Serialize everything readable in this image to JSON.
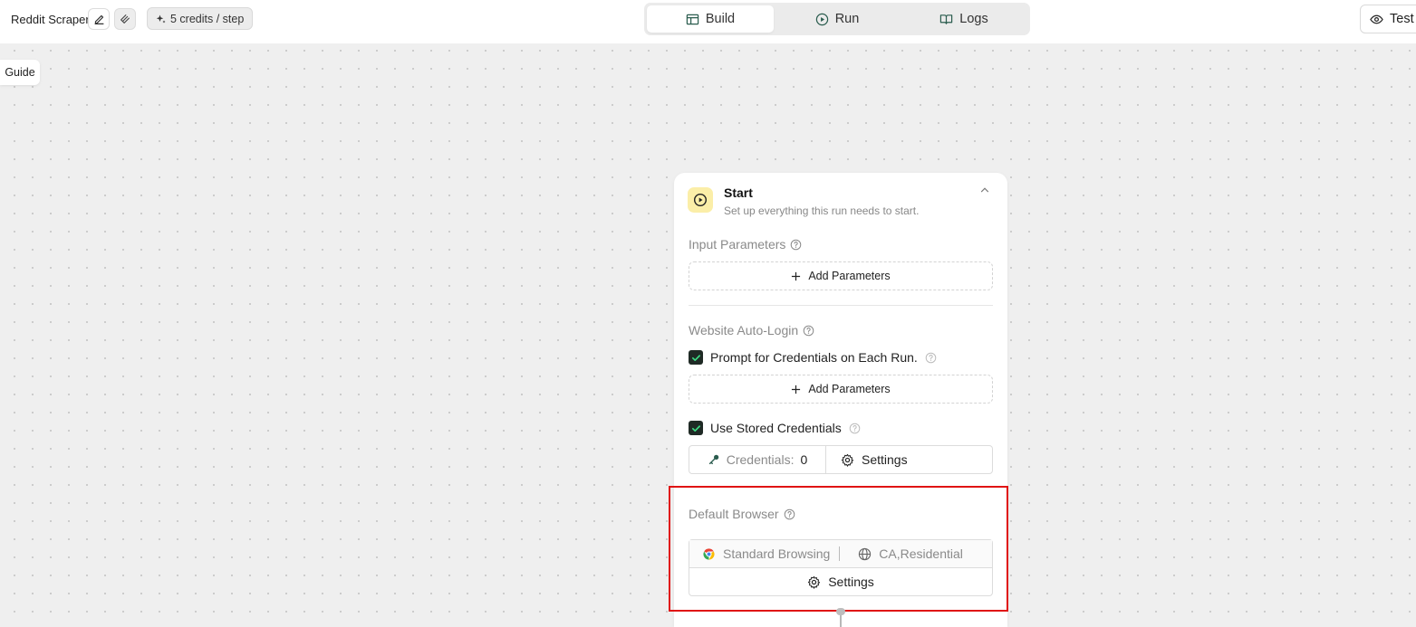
{
  "header": {
    "app_title": "Reddit Scraper",
    "credits_label": "5 credits / step",
    "tabs": [
      {
        "label": "Build",
        "icon": "table-icon",
        "active": true
      },
      {
        "label": "Run",
        "icon": "play-circle-icon",
        "active": false
      },
      {
        "label": "Logs",
        "icon": "book-icon",
        "active": false
      }
    ],
    "test_label": "Test"
  },
  "guide_label": "Guide",
  "start_node": {
    "title": "Start",
    "subtitle": "Set up everything this run needs to start.",
    "input_parameters": {
      "label": "Input Parameters",
      "add_label": "Add Parameters"
    },
    "auto_login": {
      "label": "Website Auto-Login",
      "prompt_credentials_label": "Prompt for Credentials on Each Run.",
      "prompt_credentials_checked": true,
      "add_label": "Add Parameters",
      "use_stored_label": "Use Stored Credentials",
      "use_stored_checked": true,
      "credentials_label": "Credentials:",
      "credentials_count": "0",
      "settings_label": "Settings"
    },
    "default_browser": {
      "label": "Default Browser",
      "browser_mode": "Standard Browsing",
      "proxy": "CA,Residential",
      "settings_label": "Settings"
    }
  },
  "colors": {
    "highlight": "#e01414",
    "checkbox": "#1f2a25",
    "start_icon_bg": "#fbeea8",
    "check_mark": "#3ddc84"
  }
}
